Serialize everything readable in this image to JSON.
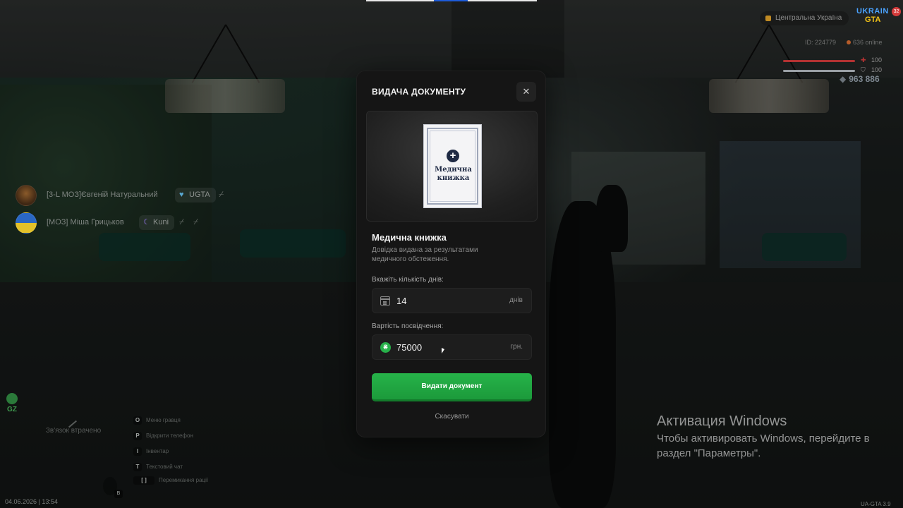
{
  "hud": {
    "region": "Центральна Україна",
    "logo_line1": "UKRAIN",
    "logo_line2": "GTA",
    "logo_badge": "32",
    "player_id": "ID: 224779",
    "online": "636 online",
    "health": "100",
    "armor": "100",
    "money": "963 886"
  },
  "voice": [
    {
      "name": "[3-L МОЗ]Євгеній Натуральний",
      "tag": "UGTA"
    },
    {
      "name": "[МОЗ] Міша Грицьков",
      "tag": "Kuni"
    }
  ],
  "bottom_left": {
    "gz": "GZ",
    "no_link": "Зв'язок втрачено",
    "hints": [
      {
        "key": "O",
        "label": "Меню гравця"
      },
      {
        "key": "P",
        "label": "Відкрити телефон"
      },
      {
        "key": "I",
        "label": "Інвентар"
      },
      {
        "key": "T",
        "label": "Текстовий чат"
      },
      {
        "key": "[   ]",
        "label": "Перемикання рації"
      }
    ],
    "mic_key": "B",
    "datetime": "04.06.2026 | 13:54",
    "version": "UA-GTA 3.9"
  },
  "modal": {
    "title": "ВИДАЧА ДОКУМЕНТУ",
    "close": "✕",
    "doc_card_title": "Медична книжка",
    "doc_heading": "Медична книжка",
    "doc_desc": "Довідка видана за результатами медичного обстеження.",
    "days_label": "Вкажіть кількість днів:",
    "days_value": "14",
    "days_suffix": "днів",
    "price_label": "Вартість посвідчення:",
    "price_value": "75000",
    "price_suffix": "грн.",
    "coin_symbol": "₴",
    "submit": "Видати документ",
    "cancel": "Скасувати"
  },
  "windows_activation": {
    "title": "Активация Windows",
    "text": "Чтобы активировать Windows, перейдите в раздел \"Параметры\"."
  }
}
